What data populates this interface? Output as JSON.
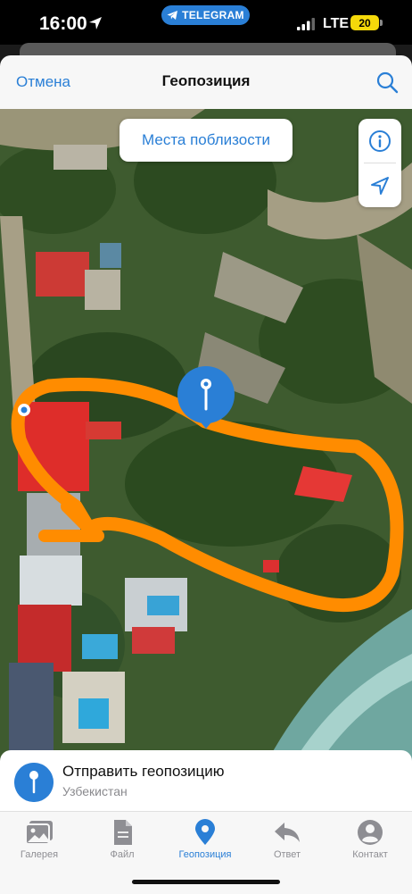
{
  "status_bar": {
    "time": "16:00",
    "telegram_pill": "TELEGRAM",
    "network": "LTE",
    "battery": "20"
  },
  "header": {
    "cancel": "Отмена",
    "title": "Геопозиция"
  },
  "map": {
    "nearby_button": "Места поблизости"
  },
  "send_location": {
    "title": "Отправить геопозицию",
    "subtitle": "Узбекистан"
  },
  "tabs": [
    {
      "label": "Галерея",
      "icon": "gallery-icon",
      "active": false
    },
    {
      "label": "Файл",
      "icon": "file-icon",
      "active": false
    },
    {
      "label": "Геопозиция",
      "icon": "location-icon",
      "active": true
    },
    {
      "label": "Ответ",
      "icon": "reply-icon",
      "active": false
    },
    {
      "label": "Контакт",
      "icon": "contact-icon",
      "active": false
    }
  ],
  "colors": {
    "accent": "#2a7fd6",
    "annotation": "#ff8c00",
    "roof": "#d9232a"
  }
}
